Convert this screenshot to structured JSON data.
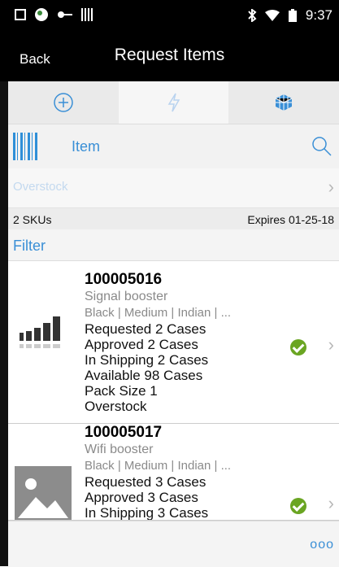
{
  "status_bar": {
    "time": "9:37"
  },
  "header": {
    "back_label": "Back",
    "title": "Request Items"
  },
  "tabs": [
    {
      "icon": "add-circle-icon"
    },
    {
      "icon": "lightning-icon"
    },
    {
      "icon": "cube-icon"
    }
  ],
  "search": {
    "label": "Item"
  },
  "context": {
    "value": "Overstock"
  },
  "summary": {
    "sku_count": "2 SKUs",
    "expires": "Expires 01-25-18"
  },
  "filter_label": "Filter",
  "items": [
    {
      "code": "100005016",
      "name": "Signal booster",
      "attributes": "Black | Medium | Indian | ...",
      "requested": "Requested  2 Cases",
      "approved": "Approved  2 Cases",
      "in_shipping": "In Shipping  2 Cases",
      "available": "Available  98 Cases",
      "pack_size": "Pack Size 1",
      "location": "Overstock"
    },
    {
      "code": "100005017",
      "name": "Wifi booster",
      "attributes": "Black | Medium | Indian | ...",
      "requested": "Requested  3 Cases",
      "approved": "Approved  3 Cases",
      "in_shipping": "In Shipping  3 Cases"
    }
  ],
  "footer": {
    "more_label": "ooo"
  },
  "colors": {
    "accent": "#3a8fd6",
    "check": "#6aa522",
    "header": "#000000"
  }
}
